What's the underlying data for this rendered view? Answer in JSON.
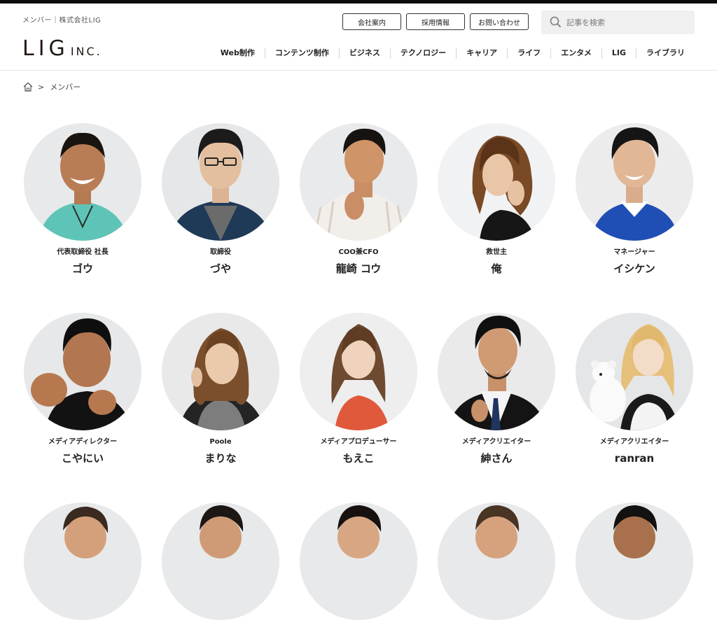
{
  "header": {
    "caption": "メンバー｜株式会社LIG",
    "logo_main": "LIG",
    "logo_sub": "INC.",
    "utility": [
      "会社案内",
      "採用情報",
      "お問い合わせ"
    ],
    "search_placeholder": "記事を検索",
    "nav": [
      "Web制作",
      "コンテンツ制作",
      "ビジネス",
      "テクノロジー",
      "キャリア",
      "ライフ",
      "エンタメ",
      "LIG",
      "ライブラリ"
    ]
  },
  "breadcrumb": {
    "current": "メンバー"
  },
  "members": [
    {
      "role": "代表取締役 社長",
      "name": "ゴウ"
    },
    {
      "role": "取締役",
      "name": "づや"
    },
    {
      "role": "COO兼CFO",
      "name": "龍崎 コウ"
    },
    {
      "role": "救世主",
      "name": "俺"
    },
    {
      "role": "マネージャー",
      "name": "イシケン"
    },
    {
      "role": "メディアディレクター",
      "name": "こやにい"
    },
    {
      "role": "Poole",
      "name": "まりな"
    },
    {
      "role": "メディアプロデューサー",
      "name": "もえこ"
    },
    {
      "role": "メディアクリエイター",
      "name": "紳さん"
    },
    {
      "role": "メディアクリエイター",
      "name": "ranran"
    }
  ],
  "colors": {
    "logo": "#231815",
    "topbar": "#0b0b0b",
    "search_bg": "#f0f0f0"
  }
}
